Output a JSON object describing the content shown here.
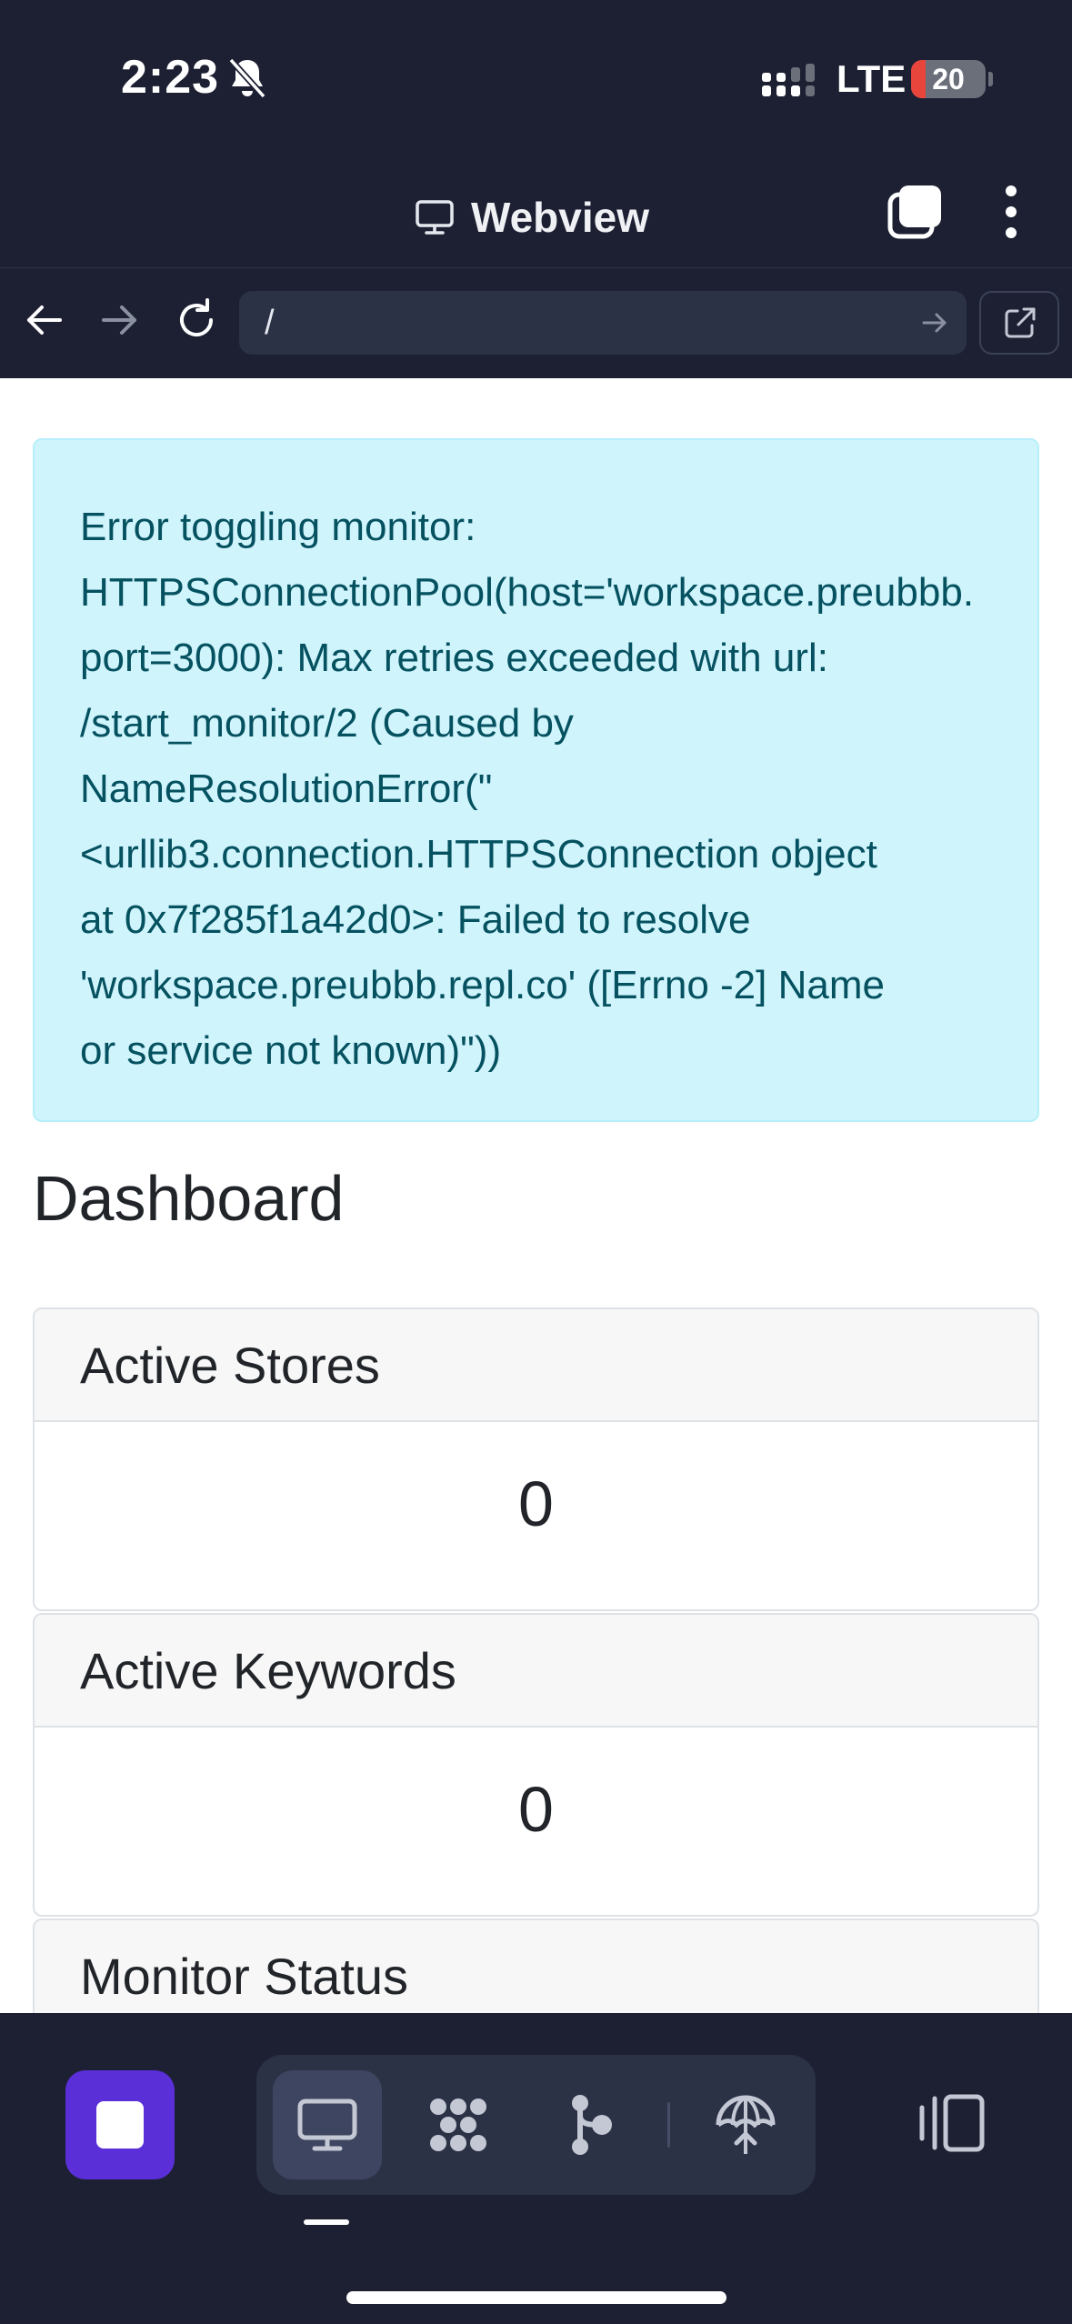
{
  "status_bar": {
    "time": "2:23",
    "network": "LTE",
    "battery": "20",
    "battery_level": 0.2,
    "icons": [
      "bell-slash-icon",
      "signal-icon"
    ]
  },
  "header": {
    "title": "Webview",
    "icons": [
      "monitor-icon",
      "tabs-icon",
      "more-vertical-icon"
    ]
  },
  "url_bar": {
    "url": "/",
    "icons": [
      "back-arrow-icon",
      "forward-arrow-icon",
      "reload-icon",
      "go-arrow-icon",
      "external-link-icon"
    ]
  },
  "page": {
    "alert": {
      "text": "Error toggling monitor:\nHTTPSConnectionPool(host='workspace.preubbb.\nport=3000): Max retries exceeded with url:\n/start_monitor/2 (Caused by\nNameResolutionError(\"\n<urllib3.connection.HTTPSConnection object\nat 0x7f285f1a42d0>: Failed to resolve\n'workspace.preubbb.repl.co' ([Errno -2] Name\nor service not known)\"))"
    },
    "title": "Dashboard",
    "cards": [
      {
        "label": "Active Stores",
        "value": "0"
      },
      {
        "label": "Active Keywords",
        "value": "0"
      },
      {
        "label": "Monitor Status",
        "value": ""
      }
    ]
  },
  "toolbar": {
    "icons": [
      "stop-icon",
      "desktop-icon",
      "packages-icon",
      "git-icon",
      "deploy-icon",
      "panel-toggle-icon"
    ],
    "active": "desktop-icon",
    "accent": "#5a2fd8"
  }
}
